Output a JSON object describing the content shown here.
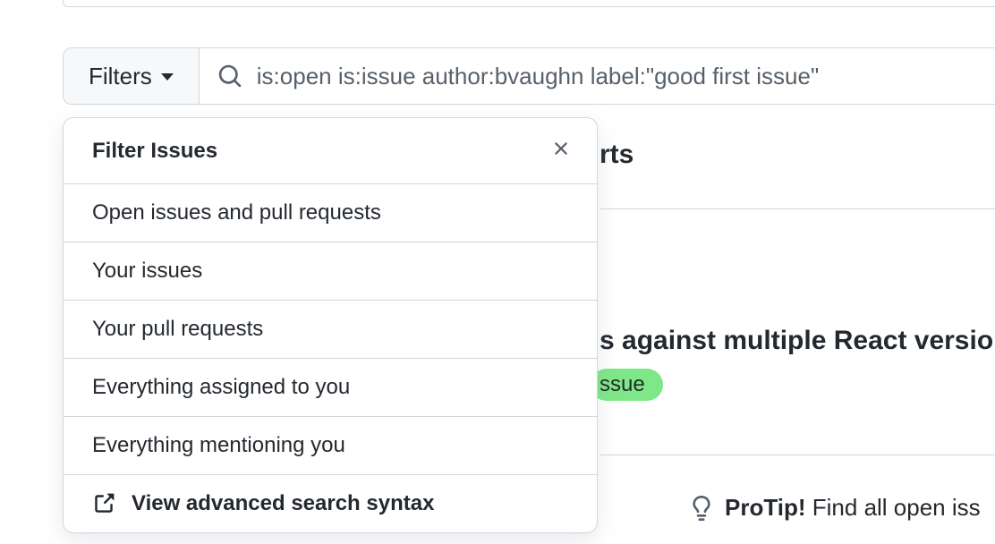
{
  "filterBar": {
    "buttonLabel": "Filters",
    "searchValue": "is:open is:issue author:bvaughn label:\"good first issue\""
  },
  "dropdown": {
    "title": "Filter Issues",
    "items": [
      "Open issues and pull requests",
      "Your issues",
      "Your pull requests",
      "Everything assigned to you",
      "Everything mentioning you"
    ],
    "footerText": "View advanced search syntax"
  },
  "background": {
    "rtsText": "rts",
    "issueTitle": "s against multiple React versio",
    "labelText": "ssue",
    "protipLabel": "ProTip!",
    "protipText": "Find all open iss"
  }
}
